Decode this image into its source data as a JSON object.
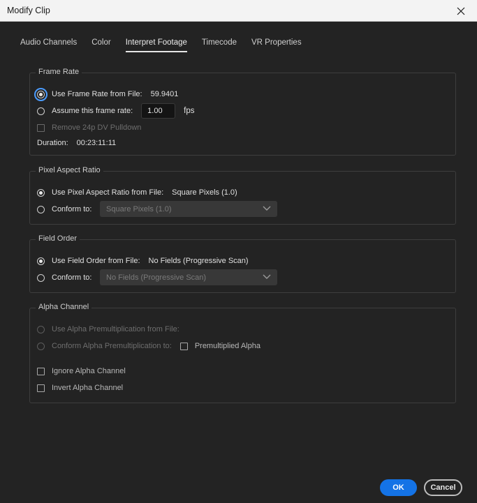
{
  "window": {
    "title": "Modify Clip"
  },
  "tabs": [
    "Audio Channels",
    "Color",
    "Interpret Footage",
    "Timecode",
    "VR Properties"
  ],
  "active_tab": "Interpret Footage",
  "frame_rate": {
    "label": "Frame Rate",
    "use_from_file_label": "Use Frame Rate from File:",
    "use_from_file_value": "59.9401",
    "assume_label": "Assume this frame rate:",
    "assume_value": "1.00",
    "assume_unit": "fps",
    "pulldown_label": "Remove 24p DV Pulldown",
    "duration_label": "Duration:",
    "duration_value": "00:23:11:11"
  },
  "pixel_aspect": {
    "label": "Pixel Aspect Ratio",
    "use_from_file_label": "Use Pixel Aspect Ratio from File:",
    "use_from_file_value": "Square Pixels (1.0)",
    "conform_label": "Conform to:",
    "conform_value": "Square Pixels (1.0)"
  },
  "field_order": {
    "label": "Field Order",
    "use_from_file_label": "Use Field Order from File:",
    "use_from_file_value": "No Fields (Progressive Scan)",
    "conform_label": "Conform to:",
    "conform_value": "No Fields (Progressive Scan)"
  },
  "alpha": {
    "label": "Alpha Channel",
    "use_from_file_label": "Use Alpha Premultiplication from File:",
    "conform_label": "Conform Alpha Premultiplication to:",
    "premultiplied_label": "Premultiplied Alpha",
    "ignore_label": "Ignore Alpha Channel",
    "invert_label": "Invert Alpha Channel"
  },
  "buttons": {
    "ok": "OK",
    "cancel": "Cancel"
  },
  "colors": {
    "accent": "#1473e6",
    "focus": "#4b9cff",
    "background": "#232323"
  },
  "icons": {
    "close": "close-icon",
    "dropdown": "chevron-down-icon"
  }
}
